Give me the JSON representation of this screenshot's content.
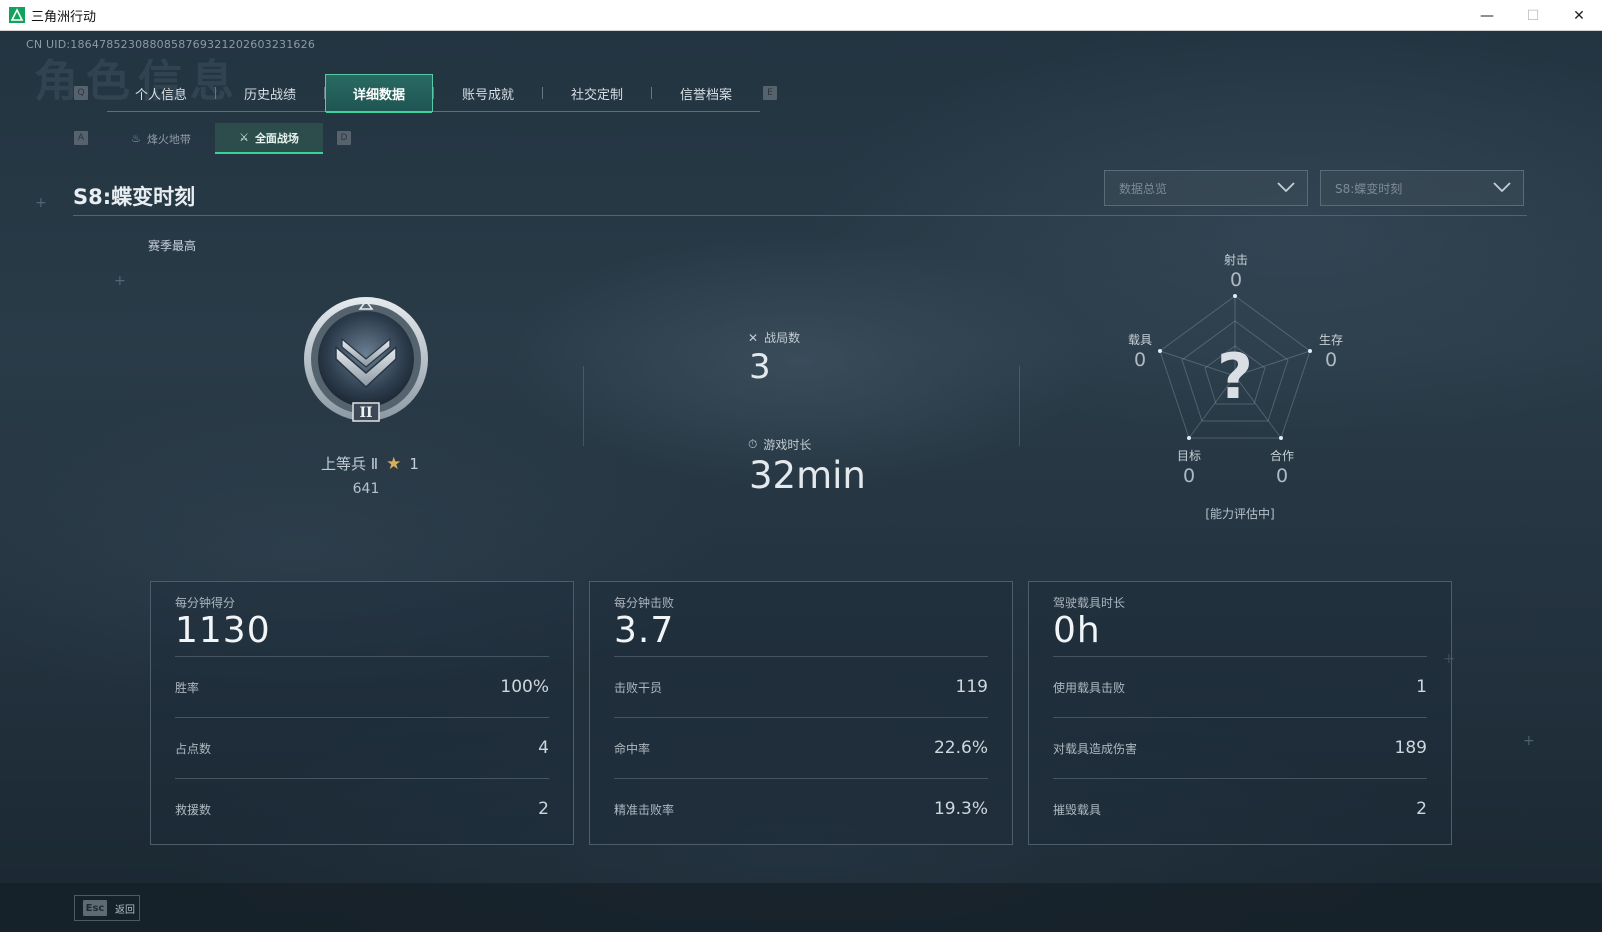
{
  "window": {
    "title": "三角洲行动",
    "min": "—",
    "max": "☐",
    "close": "✕"
  },
  "uid": "CN UID:1864785230880858769321202603231626",
  "bg_title": "角色信息",
  "keys": {
    "q": "Q",
    "e": "E",
    "a": "A",
    "d": "D"
  },
  "tabs": [
    {
      "label": "个人信息"
    },
    {
      "label": "历史战绩"
    },
    {
      "label": "详细数据"
    },
    {
      "label": "账号成就"
    },
    {
      "label": "社交定制"
    },
    {
      "label": "信誉档案"
    }
  ],
  "subtabs": [
    {
      "label": "烽火地带",
      "icon": "♨"
    },
    {
      "label": "全面战场",
      "icon": "⚔"
    }
  ],
  "season_title": "S8:蝶变时刻",
  "dropdowns": {
    "overview": "数据总览",
    "season": "S8:蝶变时刻"
  },
  "season_best": "赛季最高",
  "rank": {
    "name": "上等兵 Ⅱ",
    "stars": "1",
    "score": "641",
    "tier": "II"
  },
  "matches": {
    "label": "战局数",
    "value": "3"
  },
  "playtime": {
    "label": "游戏时长",
    "value": "32min"
  },
  "radar": {
    "shoot": {
      "label": "射击",
      "value": "0"
    },
    "survive": {
      "label": "生存",
      "value": "0"
    },
    "coop": {
      "label": "合作",
      "value": "0"
    },
    "target": {
      "label": "目标",
      "value": "0"
    },
    "vehicle": {
      "label": "载具",
      "value": "0"
    },
    "center": "?",
    "note": "[能力评估中]"
  },
  "cards": [
    {
      "title": "每分钟得分",
      "big": "1130",
      "rows": [
        {
          "label": "胜率",
          "value": "100%"
        },
        {
          "label": "占点数",
          "value": "4"
        },
        {
          "label": "救援数",
          "value": "2"
        }
      ]
    },
    {
      "title": "每分钟击败",
      "big": "3.7",
      "rows": [
        {
          "label": "击败干员",
          "value": "119"
        },
        {
          "label": "命中率",
          "value": "22.6%"
        },
        {
          "label": "精准击败率",
          "value": "19.3%"
        }
      ]
    },
    {
      "title": "驾驶载具时长",
      "big": "0h",
      "rows": [
        {
          "label": "使用载具击败",
          "value": "1"
        },
        {
          "label": "对载具造成伤害",
          "value": "189"
        },
        {
          "label": "摧毁载具",
          "value": "2"
        }
      ]
    }
  ],
  "esc": {
    "key": "Esc",
    "label": "返回"
  },
  "colors": {
    "accent": "#3bd39a",
    "active_tab_bg": "#2a6a63"
  }
}
